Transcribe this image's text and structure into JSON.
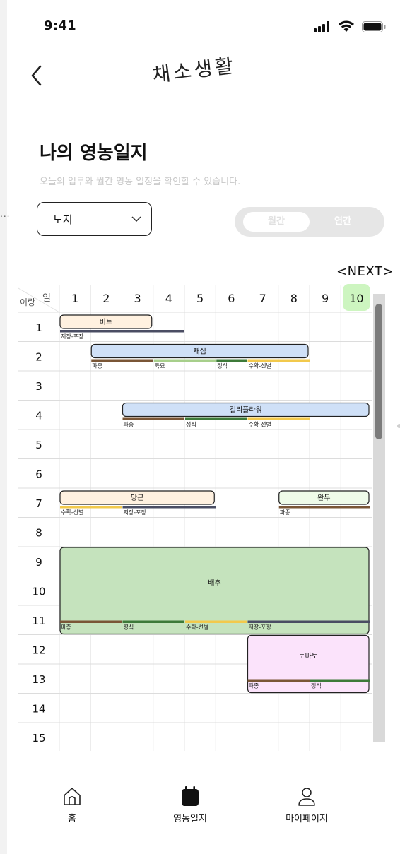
{
  "status": {
    "time": "9:41"
  },
  "header": {
    "brand": "채소생활"
  },
  "page": {
    "title": "나의 영농일지",
    "subtitle": "오늘의 업무와 월간 영농 일정을 확인할 수 있습니다.",
    "overflow_dots": "..."
  },
  "filter": {
    "selected": "노지"
  },
  "view_toggle": {
    "monthly": "월간",
    "yearly": "연간",
    "active": "monthly"
  },
  "calendar": {
    "next_label": "NEXT",
    "corner_day": "일",
    "corner_row": "이랑",
    "days": [
      "1",
      "2",
      "3",
      "4",
      "5",
      "6",
      "7",
      "8",
      "9",
      "10"
    ],
    "today": "10",
    "rows": [
      "1",
      "2",
      "3",
      "4",
      "5",
      "6",
      "7",
      "8",
      "9",
      "10",
      "11",
      "12",
      "13",
      "14",
      "15"
    ],
    "crops": [
      {
        "name": "비트",
        "row_start": 1,
        "row_end": 1,
        "day_start": 1,
        "day_end": 3,
        "fill": "#fff1e0",
        "stages": [
          {
            "label": "저장-포장",
            "day_start": 1,
            "day_end": 4,
            "color": "#4a4d63"
          }
        ]
      },
      {
        "name": "채심",
        "row_start": 2,
        "row_end": 2,
        "day_start": 2,
        "day_end": 8,
        "fill": "#cfe0f7",
        "stages": [
          {
            "label": "파종",
            "day_start": 2,
            "day_end": 3,
            "color": "#7a5636"
          },
          {
            "label": "육묘",
            "day_start": 4,
            "day_end": 5,
            "color": "#a7cf8b"
          },
          {
            "label": "정식",
            "day_start": 6,
            "day_end": 6,
            "color": "#3d7a39"
          },
          {
            "label": "수확-선별",
            "day_start": 7,
            "day_end": 8,
            "color": "#f2c94c"
          }
        ]
      },
      {
        "name": "컬리플라워",
        "row_start": 4,
        "row_end": 4,
        "day_start": 3,
        "day_end": 10,
        "fill": "#cfe0f7",
        "stages": [
          {
            "label": "파종",
            "day_start": 3,
            "day_end": 4,
            "color": "#7a5636"
          },
          {
            "label": "정식",
            "day_start": 5,
            "day_end": 6,
            "color": "#3d7a39"
          },
          {
            "label": "수확-선별",
            "day_start": 7,
            "day_end": 8,
            "color": "#f2c94c"
          }
        ]
      },
      {
        "name": "당근",
        "row_start": 7,
        "row_end": 7,
        "day_start": 1,
        "day_end": 5,
        "fill": "#fff1e0",
        "stages": [
          {
            "label": "수확-선별",
            "day_start": 1,
            "day_end": 2,
            "color": "#f2c94c"
          },
          {
            "label": "저장-포장",
            "day_start": 3,
            "day_end": 5,
            "color": "#4a4d63"
          }
        ]
      },
      {
        "name": "완두",
        "row_start": 7,
        "row_end": 7,
        "day_start": 8,
        "day_end": 10,
        "fill": "#effbe9",
        "stages": [
          {
            "label": "파종",
            "day_start": 8,
            "day_end": 10,
            "color": "#7a5636"
          }
        ]
      },
      {
        "name": "배추",
        "row_start": 9,
        "row_end": 11,
        "day_start": 1,
        "day_end": 10,
        "fill": "#c5e3bd",
        "stages": [
          {
            "label": "파종",
            "day_start": 1,
            "day_end": 2,
            "color": "#7a5636"
          },
          {
            "label": "정식",
            "day_start": 3,
            "day_end": 4,
            "color": "#3d7a39"
          },
          {
            "label": "수확-선별",
            "day_start": 5,
            "day_end": 6,
            "color": "#f2c94c"
          },
          {
            "label": "저장-포장",
            "day_start": 7,
            "day_end": 10,
            "color": "#4a4d63"
          }
        ]
      },
      {
        "name": "토마토",
        "row_start": 12,
        "row_end": 13,
        "day_start": 7,
        "day_end": 10,
        "fill": "#fbe3fb",
        "stages": [
          {
            "label": "파종",
            "day_start": 7,
            "day_end": 8,
            "color": "#7a5636"
          },
          {
            "label": "정식",
            "day_start": 9,
            "day_end": 10,
            "color": "#3d7a39"
          }
        ]
      }
    ]
  },
  "bottom_nav": {
    "home": "홈",
    "diary": "영농일지",
    "mypage": "마이페이지"
  }
}
